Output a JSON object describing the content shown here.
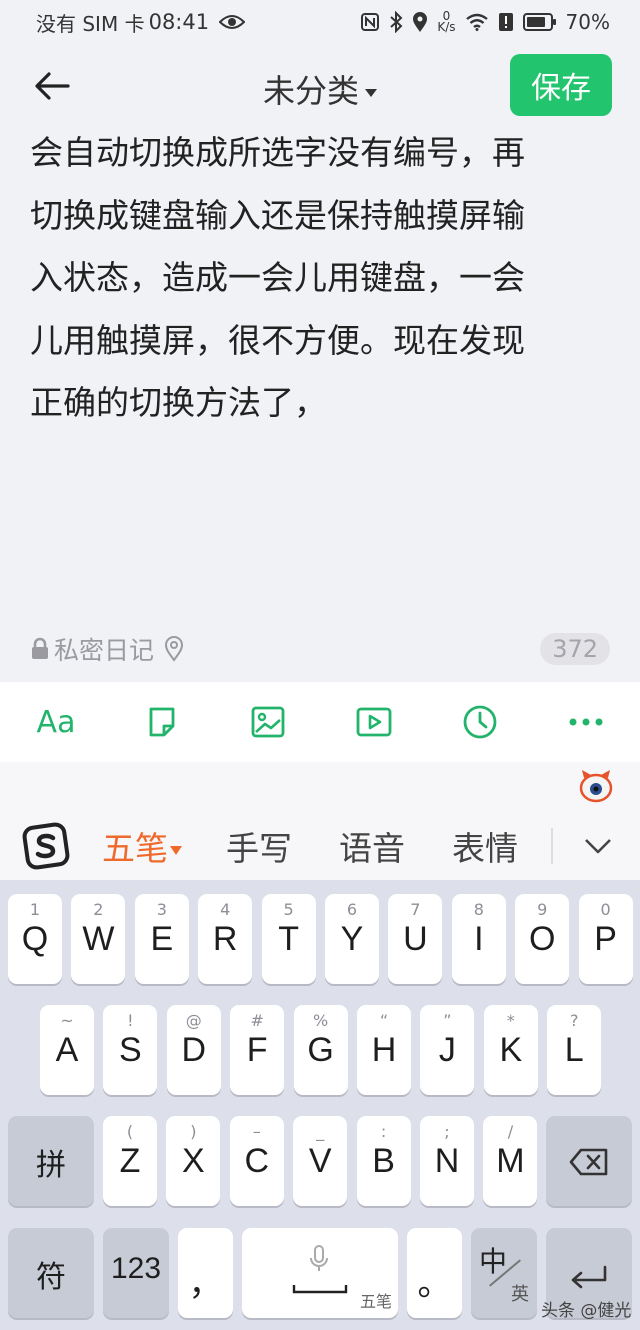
{
  "status_bar": {
    "carrier": "没有 SIM 卡",
    "time": "08:41",
    "net_speed_value": "0",
    "net_speed_unit": "K/s",
    "battery": "70%",
    "icons": [
      "eye-icon",
      "nfc-icon",
      "bluetooth-icon",
      "location-icon",
      "wifi-icon",
      "alert-icon",
      "battery-icon"
    ]
  },
  "header": {
    "category": "未分类",
    "save_label": "保存"
  },
  "note": {
    "lines": [
      "会自动切换成所选字没有编号，再",
      "切换成键盘输入还是保持触摸屏输",
      "入状态，造成一会儿用键盘，一会",
      "儿用触摸屏，很不方便。现在发现",
      "正确的切换方法了，"
    ],
    "privacy_label": "私密日记",
    "char_count": "372"
  },
  "toolbar": {
    "format_label": "Aa",
    "items": [
      "format-icon",
      "note-icon",
      "image-icon",
      "video-icon",
      "clock-icon",
      "more-icon"
    ]
  },
  "ime": {
    "tabs": [
      "五笔",
      "手写",
      "语音",
      "表情"
    ]
  },
  "keyboard": {
    "row1": [
      {
        "hint": "1",
        "label": "Q"
      },
      {
        "hint": "2",
        "label": "W"
      },
      {
        "hint": "3",
        "label": "E"
      },
      {
        "hint": "4",
        "label": "R"
      },
      {
        "hint": "5",
        "label": "T"
      },
      {
        "hint": "6",
        "label": "Y"
      },
      {
        "hint": "7",
        "label": "U"
      },
      {
        "hint": "8",
        "label": "I"
      },
      {
        "hint": "9",
        "label": "O"
      },
      {
        "hint": "0",
        "label": "P"
      }
    ],
    "row2": [
      {
        "hint": "~",
        "label": "A"
      },
      {
        "hint": "!",
        "label": "S"
      },
      {
        "hint": "@",
        "label": "D"
      },
      {
        "hint": "#",
        "label": "F"
      },
      {
        "hint": "%",
        "label": "G"
      },
      {
        "hint": "“",
        "label": "H"
      },
      {
        "hint": "”",
        "label": "J"
      },
      {
        "hint": "*",
        "label": "K"
      },
      {
        "hint": "?",
        "label": "L"
      }
    ],
    "row3": [
      {
        "hint": "(",
        "label": "Z"
      },
      {
        "hint": ")",
        "label": "X"
      },
      {
        "hint": "–",
        "label": "C"
      },
      {
        "hint": "_",
        "label": "V"
      },
      {
        "hint": ":",
        "label": "B"
      },
      {
        "hint": ";",
        "label": "N"
      },
      {
        "hint": "/",
        "label": "M"
      }
    ],
    "pinyin_label": "拼",
    "symbol_label": "符",
    "numbers_label": "123",
    "comma_label": "，",
    "space_sub_label": "五笔",
    "period_label": "。",
    "lang_main": "中",
    "lang_sub": "英"
  },
  "watermark": "头条 @健光"
}
